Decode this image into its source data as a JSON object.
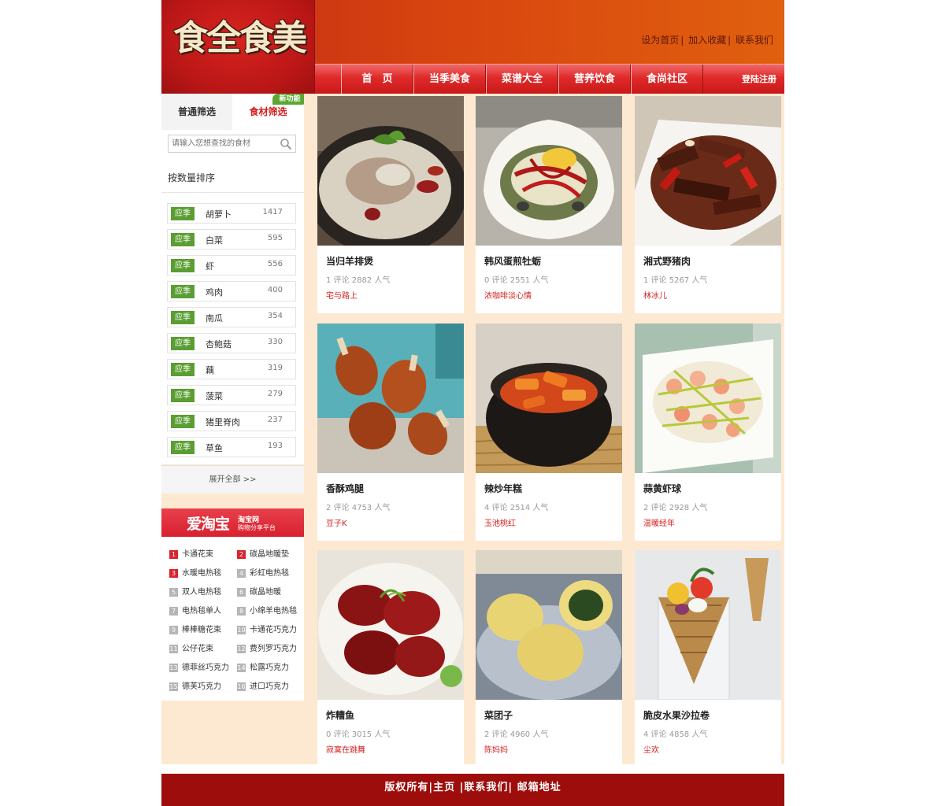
{
  "header": {
    "logo_text": "食全食美",
    "top_links": [
      "设为首页",
      "加入收藏",
      "联系我们"
    ],
    "nav": [
      "首　页",
      "当季美食",
      "菜谱大全",
      "营养饮食",
      "食尚社区"
    ],
    "login_label": "登陆注册"
  },
  "filter": {
    "tabs": [
      "普通筛选",
      "食材筛选"
    ],
    "active_tab": "食材筛选",
    "new_badge": "新功能",
    "search_placeholder": "请输入您想查找的食材",
    "sort_label": "按数量排序",
    "season_tag": "应季",
    "items": [
      {
        "name": "胡萝卜",
        "count": "1417"
      },
      {
        "name": "白菜",
        "count": "595"
      },
      {
        "name": "虾",
        "count": "556"
      },
      {
        "name": "鸡肉",
        "count": "400"
      },
      {
        "name": "南瓜",
        "count": "354"
      },
      {
        "name": "杏鲍菇",
        "count": "330"
      },
      {
        "name": "藕",
        "count": "319"
      },
      {
        "name": "菠菜",
        "count": "279"
      },
      {
        "name": "猪里脊肉",
        "count": "237"
      },
      {
        "name": "草鱼",
        "count": "193"
      }
    ],
    "show_all": "展开全部 >>"
  },
  "taobao": {
    "logo": "爱淘宝",
    "sub1": "淘宝网",
    "sub2": "购物分享平台",
    "items": [
      {
        "num": "1",
        "label": "卡通花束"
      },
      {
        "num": "2",
        "label": "碳晶地暖垫"
      },
      {
        "num": "3",
        "label": "水暖电热毯"
      },
      {
        "num": "4",
        "label": "彩虹电热毯"
      },
      {
        "num": "5",
        "label": "双人电热毯"
      },
      {
        "num": "6",
        "label": "碳晶地暖"
      },
      {
        "num": "7",
        "label": "电热毯单人"
      },
      {
        "num": "8",
        "label": "小绵羊电热毯"
      },
      {
        "num": "9",
        "label": "棒棒糖花束"
      },
      {
        "num": "10",
        "label": "卡通花巧克力"
      },
      {
        "num": "11",
        "label": "公仔花束"
      },
      {
        "num": "12",
        "label": "费列罗巧克力"
      },
      {
        "num": "13",
        "label": "德菲丝巧克力"
      },
      {
        "num": "14",
        "label": "松露巧克力"
      },
      {
        "num": "15",
        "label": "德芙巧克力"
      },
      {
        "num": "16",
        "label": "进口巧克力"
      }
    ]
  },
  "recipes": [
    {
      "title": "当归羊排煲",
      "stats": "1 评论 2882 人气",
      "author": "宅与路上",
      "image": "lamb-stew-pot"
    },
    {
      "title": "韩风蛋煎牡蛎",
      "stats": "0 评论 2551 人气",
      "author": "浓咖啡淡心情",
      "image": "oyster-omelette"
    },
    {
      "title": "湘式野猪肉",
      "stats": "1 评论 5267 人气",
      "author": "林冰儿",
      "image": "wild-boar-stirfry"
    },
    {
      "title": "香酥鸡腿",
      "stats": "2 评论 4753 人气",
      "author": "豆子K",
      "image": "fried-drumsticks"
    },
    {
      "title": "辣炒年糕",
      "stats": "4 评论 2514 人气",
      "author": "玉池桃红",
      "image": "spicy-rice-cake"
    },
    {
      "title": "蒜黄虾球",
      "stats": "2 评论 2928 人气",
      "author": "温暖经年",
      "image": "shrimp-garlic-chives"
    },
    {
      "title": "炸糟鱼",
      "stats": "0 评论 3015 人气",
      "author": "寂寞在跳舞",
      "image": "fried-red-fish"
    },
    {
      "title": "菜团子",
      "stats": "2 评论 4960 人气",
      "author": "陈妈妈",
      "image": "vegetable-buns"
    },
    {
      "title": "脆皮水果沙拉卷",
      "stats": "4 评论 4858 人气",
      "author": "尘欢",
      "image": "fruit-cone"
    }
  ],
  "footer": {
    "links": [
      "版权所有",
      "主页",
      "联系我们",
      "邮箱地址"
    ],
    "text": "版权所有|主页 |联系我们| 邮箱地址"
  },
  "colors": {
    "accent_red": "#d42020",
    "season_green": "#5a9e32",
    "footer": "#9c0d0b",
    "panel_bg": "#fde9d2"
  }
}
